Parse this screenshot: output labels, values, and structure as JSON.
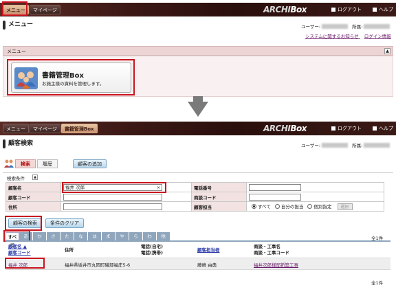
{
  "top": {
    "tabs": [
      {
        "label": "メニュー",
        "active": true
      },
      {
        "label": "マイページ",
        "active": false
      }
    ],
    "logo": {
      "pre": "ARCHI",
      "post": "Box"
    },
    "nav": [
      {
        "label": "ログアウト",
        "icon": "logout-icon"
      },
      {
        "label": "ヘルプ",
        "icon": "help-icon"
      }
    ]
  },
  "menu_page": {
    "title": "メニュー",
    "user_label": "ユーザー:",
    "org_label": "所属:",
    "links": [
      "システムに関するお知らせ",
      "ログイン情報"
    ],
    "section_label": "メニュー",
    "card": {
      "title": "書籍管理Box",
      "subtitle": "お施主様の資料を管理します。"
    }
  },
  "search_page": {
    "tabs": [
      {
        "label": "メニュー",
        "active": false
      },
      {
        "label": "マイページ",
        "active": false
      },
      {
        "label": "書籍管理Box",
        "active": true
      }
    ],
    "title": "顧客検索",
    "user_label": "ユーザー:",
    "org_label": "所属:",
    "subtabs": [
      {
        "label": "検索",
        "active": true
      },
      {
        "label": "履歴",
        "active": false
      }
    ],
    "add_button": "顧客の追加",
    "conditions_label": "検索条件",
    "fields": {
      "name_label": "顧客名",
      "name_value": "福井 次郎",
      "code_label": "顧客コード",
      "code_value": "",
      "address_label": "住所",
      "address_value": "",
      "phone_label": "電話番号",
      "phone_value": "",
      "deal_code_label": "商談コード",
      "deal_code_value": "",
      "staff_label": "顧客担当",
      "staff_options": [
        "すべて",
        "自分の担当",
        "個別指定"
      ],
      "staff_selected": "すべて",
      "select_button": "選択"
    },
    "search_button": "顧客の検索",
    "clear_button": "条件のクリア",
    "kana_tabs": [
      "すべて",
      "あ",
      "か",
      "さ",
      "た",
      "な",
      "は",
      "ま",
      "や",
      "ら",
      "わ",
      "他"
    ],
    "count_text": "全1件",
    "columns": {
      "name": "顧客名",
      "name_sort": "▲",
      "code": "顧客コード",
      "address": "住所",
      "phone": "電話(自宅)",
      "mobile": "電話(携帯)",
      "staff": "顧客担当者",
      "deal": "商談・工事名",
      "deal_code": "商談・工事コード"
    },
    "rows": [
      {
        "name": "福井 次郎",
        "address": "福井県坂井市丸岡町磯部福庄5-6",
        "staff": "藤嶋 由典",
        "deal": "福井次郎様邸新築工事"
      }
    ],
    "footer_count": "全1件"
  },
  "colors": {
    "highlight": "#c8141e",
    "header_dark": "#2a0f0d",
    "label_bg": "#f2e2e2"
  }
}
